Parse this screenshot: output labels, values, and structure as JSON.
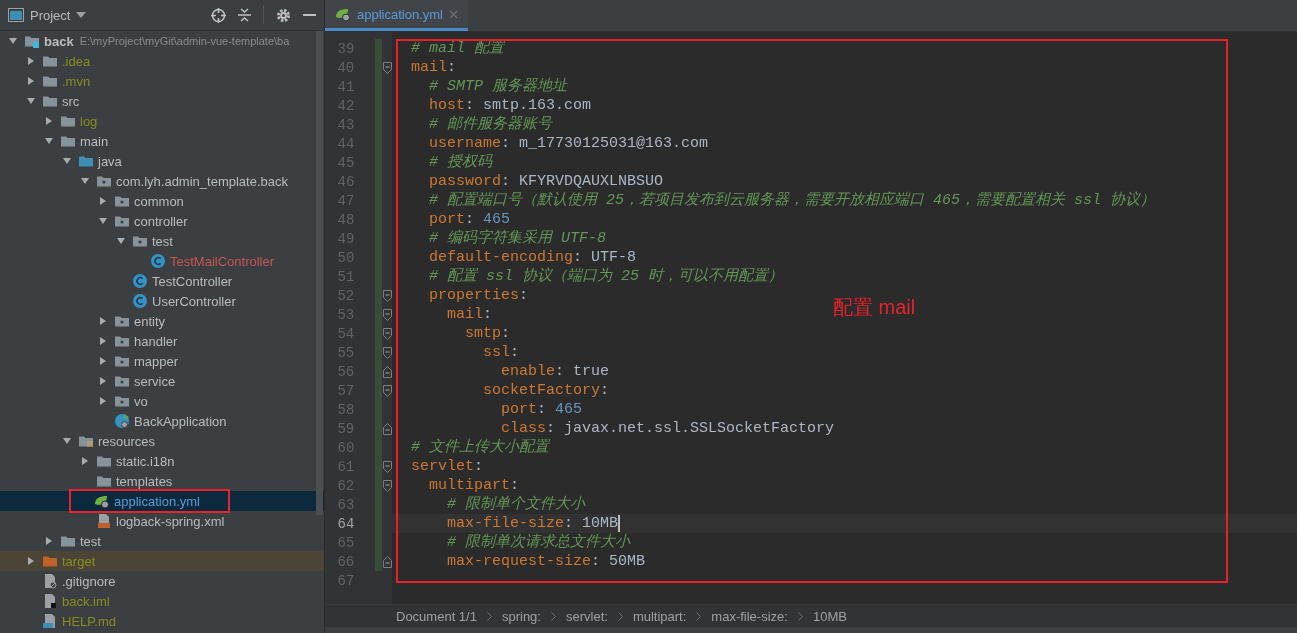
{
  "project_panel": {
    "title": "Project",
    "tree": [
      {
        "label": "back",
        "path": "E:\\myProject\\myGit\\admin-vue-template\\ba",
        "kind": "module",
        "color": "#bbbbbb",
        "selected": false,
        "expanded": true,
        "children": [
          {
            "label": ".idea",
            "kind": "folder",
            "color": "#888c1c",
            "selected": false,
            "expanded": false
          },
          {
            "label": ".mvn",
            "kind": "folder",
            "color": "#888c1c",
            "selected": false,
            "expanded": false
          },
          {
            "label": "src",
            "kind": "folder",
            "color": "#bbbbbb",
            "selected": false,
            "expanded": true,
            "children": [
              {
                "label": "log",
                "kind": "folder",
                "color": "#888c1c",
                "selected": false,
                "expanded": false
              },
              {
                "label": "main",
                "kind": "folder",
                "color": "#bbbbbb",
                "selected": false,
                "expanded": true,
                "children": [
                  {
                    "label": "java",
                    "kind": "source-folder",
                    "color": "#bbbbbb",
                    "selected": false,
                    "expanded": true,
                    "children": [
                      {
                        "label": "com.lyh.admin_template.back",
                        "kind": "package",
                        "color": "#bbbbbb",
                        "selected": false,
                        "expanded": true,
                        "children": [
                          {
                            "label": "common",
                            "kind": "package",
                            "color": "#bbbbbb",
                            "selected": false,
                            "expanded": false
                          },
                          {
                            "label": "controller",
                            "kind": "package",
                            "color": "#bbbbbb",
                            "selected": false,
                            "expanded": true,
                            "children": [
                              {
                                "label": "test",
                                "kind": "package",
                                "color": "#bbbbbb",
                                "selected": false,
                                "expanded": true,
                                "children": [
                                  {
                                    "label": "TestMailController",
                                    "kind": "class",
                                    "color": "#c75450",
                                    "selected": false
                                  }
                                ]
                              },
                              {
                                "label": "TestController",
                                "kind": "class",
                                "color": "#bbbbbb",
                                "selected": false
                              },
                              {
                                "label": "UserController",
                                "kind": "class",
                                "color": "#bbbbbb",
                                "selected": false
                              }
                            ]
                          },
                          {
                            "label": "entity",
                            "kind": "package",
                            "color": "#bbbbbb",
                            "selected": false,
                            "expanded": false
                          },
                          {
                            "label": "handler",
                            "kind": "package",
                            "color": "#bbbbbb",
                            "selected": false,
                            "expanded": false
                          },
                          {
                            "label": "mapper",
                            "kind": "package",
                            "color": "#bbbbbb",
                            "selected": false,
                            "expanded": false
                          },
                          {
                            "label": "service",
                            "kind": "package",
                            "color": "#bbbbbb",
                            "selected": false,
                            "expanded": false
                          },
                          {
                            "label": "vo",
                            "kind": "package",
                            "color": "#bbbbbb",
                            "selected": false,
                            "expanded": false
                          },
                          {
                            "label": "BackApplication",
                            "kind": "app-class",
                            "color": "#bbbbbb",
                            "selected": false
                          }
                        ]
                      }
                    ]
                  },
                  {
                    "label": "resources",
                    "kind": "resources-folder",
                    "color": "#bbbbbb",
                    "selected": false,
                    "expanded": true,
                    "children": [
                      {
                        "label": "static.i18n",
                        "kind": "folder",
                        "color": "#bbbbbb",
                        "selected": false,
                        "expanded": false
                      },
                      {
                        "label": "templates",
                        "kind": "folder",
                        "color": "#bbbbbb",
                        "selected": false
                      },
                      {
                        "label": "application.yml",
                        "kind": "yml",
                        "color": "#5a9bd5",
                        "selected": true
                      },
                      {
                        "label": "logback-spring.xml",
                        "kind": "xml",
                        "color": "#bbbbbb",
                        "selected": false
                      }
                    ]
                  }
                ]
              },
              {
                "label": "test",
                "kind": "folder",
                "color": "#bbbbbb",
                "selected": false,
                "expanded": false
              }
            ]
          },
          {
            "label": "target",
            "kind": "excluded-folder",
            "color": "#888c1c",
            "selected": false,
            "expanded": false
          },
          {
            "label": ".gitignore",
            "kind": "gitignore",
            "color": "#bbbbbb",
            "selected": false
          },
          {
            "label": "back.iml",
            "kind": "iml",
            "color": "#888c1c",
            "selected": false
          },
          {
            "label": "HELP.md",
            "kind": "md",
            "color": "#888c1c",
            "selected": false
          }
        ]
      }
    ]
  },
  "tabs": [
    {
      "label": "application.yml",
      "selected": true
    }
  ],
  "editor": {
    "annotation": "配置 mail",
    "lines": [
      {
        "number": "39",
        "changed": true,
        "current": false,
        "parts": [
          {
            "kind": "comment",
            "text": "# mail 配置"
          }
        ]
      },
      {
        "number": "40",
        "fold": {
          "kind": "start"
        },
        "changed": true,
        "current": false,
        "parts": [
          {
            "kind": "key",
            "text": "mail"
          },
          {
            "kind": "punct",
            "text": ":"
          }
        ]
      },
      {
        "number": "41",
        "changed": true,
        "current": false,
        "parts": [
          {
            "kind": "comment",
            "text": "  # SMTP 服务器地址"
          }
        ]
      },
      {
        "number": "42",
        "changed": true,
        "current": false,
        "parts": [
          {
            "kind": "key",
            "text": "  host"
          },
          {
            "kind": "punct",
            "text": ": "
          },
          {
            "kind": "value",
            "text": "smtp.163.com"
          }
        ]
      },
      {
        "number": "43",
        "changed": true,
        "current": false,
        "parts": [
          {
            "kind": "comment",
            "text": "  # 邮件服务器账号"
          }
        ]
      },
      {
        "number": "44",
        "changed": true,
        "current": false,
        "parts": [
          {
            "kind": "key",
            "text": "  username"
          },
          {
            "kind": "punct",
            "text": ": "
          },
          {
            "kind": "value",
            "text": "m_17730125031@163.com"
          }
        ]
      },
      {
        "number": "45",
        "changed": true,
        "current": false,
        "parts": [
          {
            "kind": "comment",
            "text": "  # 授权码"
          }
        ]
      },
      {
        "number": "46",
        "changed": true,
        "current": false,
        "parts": [
          {
            "kind": "key",
            "text": "  password"
          },
          {
            "kind": "punct",
            "text": ": "
          },
          {
            "kind": "value",
            "text": "KFYRVDQAUXLNBSUO"
          }
        ]
      },
      {
        "number": "47",
        "changed": true,
        "current": false,
        "parts": [
          {
            "kind": "comment",
            "text": "  # 配置端口号（默认使用 25，若项目发布到云服务器，需要开放相应端口 465，需要配置相关 ssl 协议）"
          }
        ]
      },
      {
        "number": "48",
        "changed": true,
        "current": false,
        "parts": [
          {
            "kind": "key",
            "text": "  port"
          },
          {
            "kind": "punct",
            "text": ": "
          },
          {
            "kind": "number",
            "text": "465"
          }
        ]
      },
      {
        "number": "49",
        "changed": true,
        "current": false,
        "parts": [
          {
            "kind": "comment",
            "text": "  # 编码字符集采用 UTF-8"
          }
        ]
      },
      {
        "number": "50",
        "changed": true,
        "current": false,
        "parts": [
          {
            "kind": "key",
            "text": "  default-encoding"
          },
          {
            "kind": "punct",
            "text": ": "
          },
          {
            "kind": "value",
            "text": "UTF-8"
          }
        ]
      },
      {
        "number": "51",
        "changed": true,
        "current": false,
        "parts": [
          {
            "kind": "comment",
            "text": "  # 配置 ssl 协议（端口为 25 时，可以不用配置）"
          }
        ]
      },
      {
        "number": "52",
        "fold": {
          "kind": "start"
        },
        "changed": true,
        "current": false,
        "parts": [
          {
            "kind": "key",
            "text": "  properties"
          },
          {
            "kind": "punct",
            "text": ":"
          }
        ]
      },
      {
        "number": "53",
        "fold": {
          "kind": "start"
        },
        "changed": true,
        "current": false,
        "parts": [
          {
            "kind": "key",
            "text": "    mail"
          },
          {
            "kind": "punct",
            "text": ":"
          }
        ]
      },
      {
        "number": "54",
        "fold": {
          "kind": "start"
        },
        "changed": true,
        "current": false,
        "parts": [
          {
            "kind": "key",
            "text": "      smtp"
          },
          {
            "kind": "punct",
            "text": ":"
          }
        ]
      },
      {
        "number": "55",
        "fold": {
          "kind": "start"
        },
        "changed": true,
        "current": false,
        "parts": [
          {
            "kind": "key",
            "text": "        ssl"
          },
          {
            "kind": "punct",
            "text": ":"
          }
        ]
      },
      {
        "number": "56",
        "fold": {
          "kind": "end"
        },
        "changed": true,
        "current": false,
        "parts": [
          {
            "kind": "key",
            "text": "          enable"
          },
          {
            "kind": "punct",
            "text": ": "
          },
          {
            "kind": "value",
            "text": "true"
          }
        ]
      },
      {
        "number": "57",
        "fold": {
          "kind": "start"
        },
        "changed": true,
        "current": false,
        "parts": [
          {
            "kind": "key",
            "text": "        socketFactory"
          },
          {
            "kind": "punct",
            "text": ":"
          }
        ]
      },
      {
        "number": "58",
        "changed": true,
        "current": false,
        "parts": [
          {
            "kind": "key",
            "text": "          port"
          },
          {
            "kind": "punct",
            "text": ": "
          },
          {
            "kind": "number",
            "text": "465"
          }
        ]
      },
      {
        "number": "59",
        "fold": {
          "kind": "end"
        },
        "changed": true,
        "current": false,
        "parts": [
          {
            "kind": "key",
            "text": "          class"
          },
          {
            "kind": "punct",
            "text": ": "
          },
          {
            "kind": "value",
            "text": "javax.net.ssl.SSLSocketFactory"
          }
        ]
      },
      {
        "number": "60",
        "changed": true,
        "current": false,
        "parts": [
          {
            "kind": "comment",
            "text": "# 文件上传大小配置"
          }
        ]
      },
      {
        "number": "61",
        "fold": {
          "kind": "start"
        },
        "changed": true,
        "current": false,
        "parts": [
          {
            "kind": "key",
            "text": "servlet"
          },
          {
            "kind": "punct",
            "text": ":"
          }
        ]
      },
      {
        "number": "62",
        "fold": {
          "kind": "start"
        },
        "changed": true,
        "current": false,
        "parts": [
          {
            "kind": "key",
            "text": "  multipart"
          },
          {
            "kind": "punct",
            "text": ":"
          }
        ]
      },
      {
        "number": "63",
        "changed": true,
        "current": false,
        "parts": [
          {
            "kind": "comment",
            "text": "    # 限制单个文件大小"
          }
        ]
      },
      {
        "number": "64",
        "changed": true,
        "current": true,
        "parts": [
          {
            "kind": "key",
            "text": "    max-file-size"
          },
          {
            "kind": "punct",
            "text": ": "
          },
          {
            "kind": "value",
            "text": "10MB"
          }
        ]
      },
      {
        "number": "65",
        "changed": true,
        "current": false,
        "parts": [
          {
            "kind": "comment",
            "text": "    # 限制单次请求总文件大小"
          }
        ]
      },
      {
        "number": "66",
        "fold": {
          "kind": "end"
        },
        "changed": true,
        "current": false,
        "parts": [
          {
            "kind": "key",
            "text": "    max-request-size"
          },
          {
            "kind": "punct",
            "text": ": "
          },
          {
            "kind": "value",
            "text": "50MB"
          }
        ]
      },
      {
        "number": "67",
        "changed": false,
        "current": false
      }
    ]
  },
  "breadcrumbs": [
    "Document 1/1",
    "spring:",
    "servlet:",
    "multipart:",
    "max-file-size:",
    "10MB"
  ]
}
